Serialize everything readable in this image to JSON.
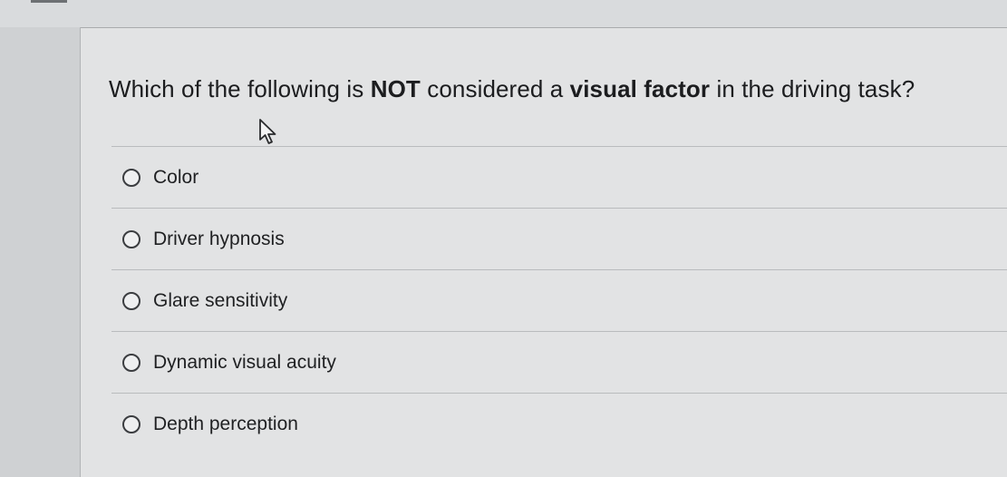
{
  "question": {
    "part1": "Which of the following is ",
    "emphasis1": "NOT",
    "part2": " considered a ",
    "emphasis2": "visual factor",
    "part3": " in the driving task?"
  },
  "answers": [
    {
      "label": "Color",
      "selected": false
    },
    {
      "label": "Driver hypnosis",
      "selected": false
    },
    {
      "label": "Glare sensitivity",
      "selected": false
    },
    {
      "label": "Dynamic visual acuity",
      "selected": false
    },
    {
      "label": "Depth perception",
      "selected": false
    }
  ],
  "icons": {
    "cursor": "mouse-pointer-icon",
    "radio": "radio-circle-icon"
  },
  "colors": {
    "background": "#e2e3e4",
    "text": "#1c1d1f",
    "divider": "#b9bbbd"
  }
}
